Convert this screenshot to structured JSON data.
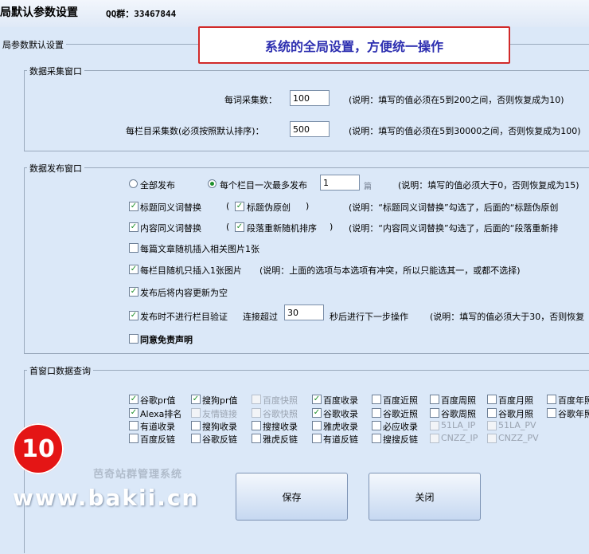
{
  "window": {
    "title": "局默认参数设置",
    "qq_group": "QQ群：33467844"
  },
  "callout": "系统的全局设置，方便统一操作",
  "outer_group": {
    "legend": "局参数默认设置"
  },
  "collect": {
    "legend": "数据采集窗口",
    "per_word_label": "每词采集数：",
    "per_word_value": "100",
    "per_word_note": "(说明：填写的值必须在5到200之间，否则恢复成为10)",
    "per_column_label": "每栏目采集数(必须按照默认排序)：",
    "per_column_value": "500",
    "per_column_note": "(说明：填写的值必须在5到30000之间，否则恢复成为100)"
  },
  "publish": {
    "legend": "数据发布窗口",
    "radio_all": "全部发布",
    "radio_each": "每个栏目一次最多发布",
    "each_value": "1",
    "each_unit": "篇",
    "each_note": "(说明：填写的值必须大于0，否则恢复成为15)",
    "title_synonym": "标题同义词替换",
    "title_fake_original": "标题伪原创",
    "title_note": "(说明：“标题同义词替换”勾选了，后面的“标题伪原创",
    "content_synonym": "内容同义词替换",
    "paragraph_shuffle": "段落重新随机排序",
    "content_note": "(说明：“内容同义词替换”勾选了，后面的“段落重新排",
    "random_image_each": "每篇文章随机插入相关图片1张",
    "random_image_column": "每栏目随机只插入1张图片",
    "random_image_note": "(说明：上面的选项与本选项有冲突，所以只能选其一，或都不选择)",
    "clear_after": "发布后将内容更新为空",
    "no_verify": "发布时不进行栏目验证",
    "timeout_prefix": "连接超过",
    "timeout_value": "30",
    "timeout_suffix": "秒后进行下一步操作",
    "timeout_note": "(说明：填写的值必须大于30，否则恢复",
    "disclaimer": "同意免责声明"
  },
  "query": {
    "legend": "首窗口数据查询",
    "rows": [
      [
        {
          "label": "谷歌pr值",
          "checked": true,
          "disabled": false
        },
        {
          "label": "搜狗pr值",
          "checked": true,
          "disabled": false
        },
        {
          "label": "百度快照",
          "checked": false,
          "disabled": true
        },
        {
          "label": "百度收录",
          "checked": true,
          "disabled": false
        },
        {
          "label": "百度近照",
          "checked": false,
          "disabled": false
        },
        {
          "label": "百度周照",
          "checked": false,
          "disabled": false
        },
        {
          "label": "百度月照",
          "checked": false,
          "disabled": false
        },
        {
          "label": "百度年照",
          "checked": false,
          "disabled": false
        }
      ],
      [
        {
          "label": "Alexa排名",
          "checked": true,
          "disabled": false
        },
        {
          "label": "友情链接",
          "checked": false,
          "disabled": true
        },
        {
          "label": "谷歌快照",
          "checked": false,
          "disabled": true
        },
        {
          "label": "谷歌收录",
          "checked": true,
          "disabled": false
        },
        {
          "label": "谷歌近照",
          "checked": false,
          "disabled": false
        },
        {
          "label": "谷歌周照",
          "checked": false,
          "disabled": false
        },
        {
          "label": "谷歌月照",
          "checked": false,
          "disabled": false
        },
        {
          "label": "谷歌年照",
          "checked": false,
          "disabled": false
        }
      ],
      [
        {
          "label": "有道收录",
          "checked": false,
          "disabled": false
        },
        {
          "label": "搜狗收录",
          "checked": false,
          "disabled": false
        },
        {
          "label": "搜搜收录",
          "checked": false,
          "disabled": false
        },
        {
          "label": "雅虎收录",
          "checked": false,
          "disabled": false
        },
        {
          "label": "必应收录",
          "checked": false,
          "disabled": false
        },
        {
          "label": "51LA_IP",
          "checked": false,
          "disabled": true
        },
        {
          "label": "51LA_PV",
          "checked": false,
          "disabled": true
        }
      ],
      [
        {
          "label": "百度反链",
          "checked": false,
          "disabled": false
        },
        {
          "label": "谷歌反链",
          "checked": false,
          "disabled": false
        },
        {
          "label": "雅虎反链",
          "checked": false,
          "disabled": false
        },
        {
          "label": "有道反链",
          "checked": false,
          "disabled": false
        },
        {
          "label": "搜搜反链",
          "checked": false,
          "disabled": false
        },
        {
          "label": "CNZZ_IP",
          "checked": false,
          "disabled": true
        },
        {
          "label": "CNZZ_PV",
          "checked": false,
          "disabled": true
        }
      ]
    ]
  },
  "buttons": {
    "save": "保存",
    "close": "关闭"
  },
  "overlay": {
    "step_number": "10",
    "watermark_cn": "芭奇站群管理系统",
    "watermark_url": "www.bakii.cn"
  }
}
